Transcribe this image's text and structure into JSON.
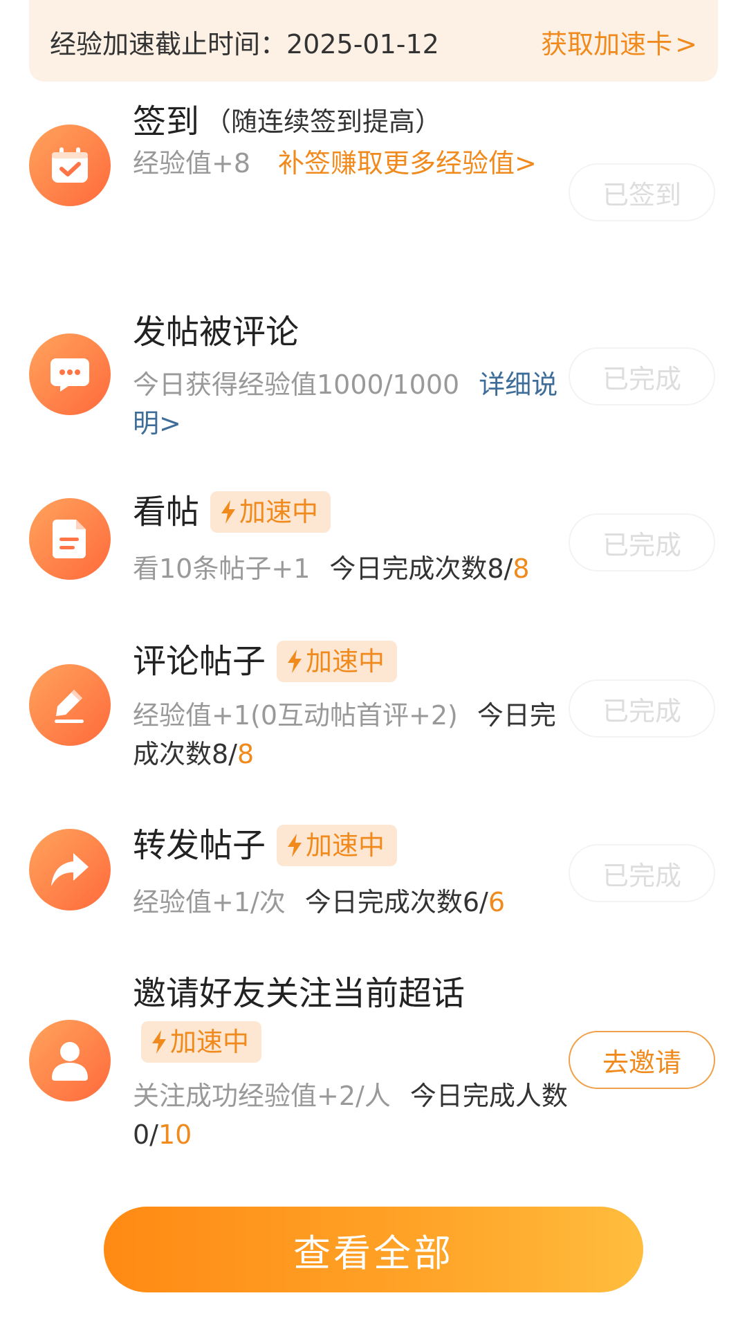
{
  "banner": {
    "deadline_text": "经验加速截止时间：2025-01-12",
    "link_label": "获取加速卡",
    "link_chevron": ">"
  },
  "badge_label": "加速中",
  "tasks": {
    "checkin": {
      "icon": "calendar-check-icon",
      "title": "签到",
      "title_sub": "（随连续签到提高）",
      "desc_value": "经验值+8",
      "desc_link": "补签赚取更多经验值>",
      "status": "已签到"
    },
    "post_commented": {
      "icon": "chat-bubble-icon",
      "title": "发帖被评论",
      "desc_value": "今日获得经验值1000/1000",
      "desc_link": "详细说明>",
      "status": "已完成"
    },
    "view_posts": {
      "icon": "document-icon",
      "title": "看帖",
      "desc_value": "看10条帖子+1",
      "desc_count_label": "今日完成次数8/",
      "desc_count_total": "8",
      "status": "已完成"
    },
    "comment_posts": {
      "icon": "pencil-icon",
      "title": "评论帖子",
      "desc_value": "经验值+1(0互动帖首评+2)",
      "desc_count_label": "今日完成次数8/",
      "desc_count_total": "8",
      "status": "已完成"
    },
    "share_posts": {
      "icon": "share-arrow-icon",
      "title": "转发帖子",
      "desc_value": "经验值+1/次",
      "desc_count_label": "今日完成次数6/",
      "desc_count_total": "6",
      "status": "已完成"
    },
    "invite_friends": {
      "icon": "user-icon",
      "title": "邀请好友关注当前超话",
      "desc_value": "关注成功经验值+2/人",
      "desc_count_label": "今日完成人数0/",
      "desc_count_total": "10",
      "action": "去邀请"
    }
  },
  "footer": {
    "view_all_label": "查看全部"
  },
  "colors": {
    "accent": "#f08a1d",
    "banner_bg": "#fdf1e6",
    "link_blue": "#3f6d9a",
    "muted": "#999999",
    "done_text": "#dddddd"
  }
}
